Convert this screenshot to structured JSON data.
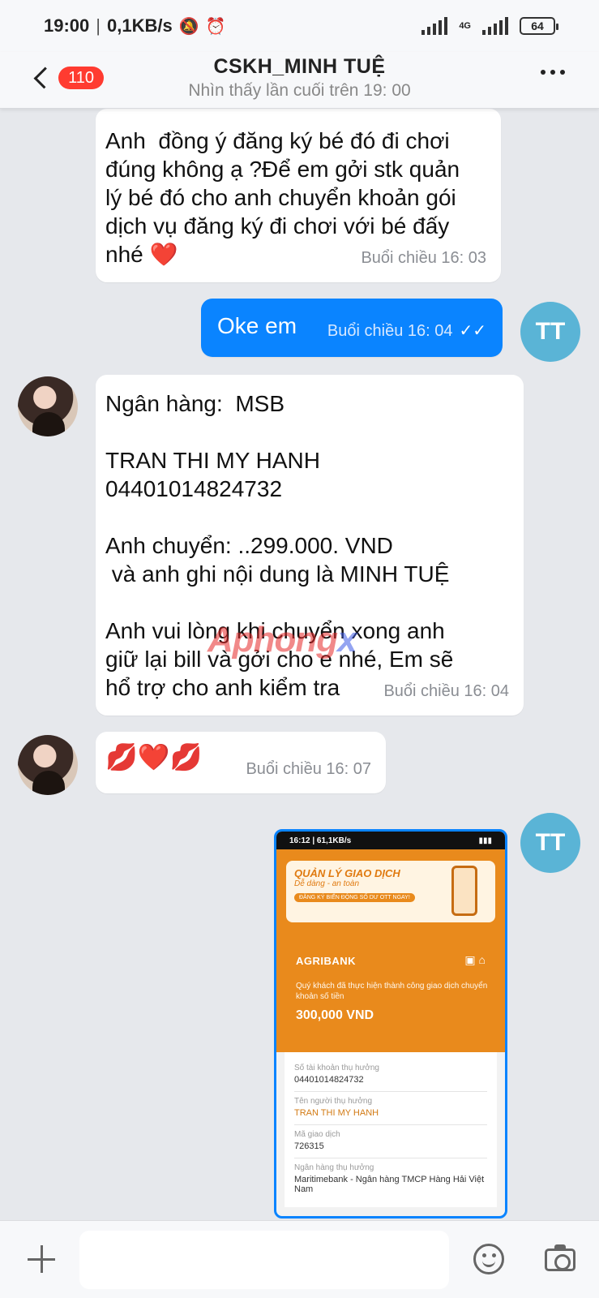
{
  "status_bar": {
    "time": "19:00",
    "speed": "0,1KB/s",
    "network": "4G",
    "battery": "64"
  },
  "header": {
    "unread_count": "110",
    "title": "CSKH_MINH TUỆ",
    "subtitle": "Nhìn thấy lần cuối trên 19: 00"
  },
  "messages": [
    {
      "sender": "other",
      "text": "Anh  đồng ý đăng ký bé đó đi chơi\nđúng không ạ ?Để em gởi stk quản\nlý bé đó cho anh chuyển khoản gói\ndịch vụ đăng ký đi chơi với bé đấy\nnhé ❤️",
      "time": "Buổi chiều  16: 03"
    },
    {
      "sender": "me",
      "text": "Oke em",
      "time": "Buổi chiều  16: 04"
    },
    {
      "sender": "other",
      "text": "Ngân hàng:  MSB\n\nTRAN THI MY HANH\n04401014824732\n\nAnh chuyển: ..299.000. VND\n và anh ghi nội dung là MINH TUỆ\n\nAnh vui lòng khi chuyển xong anh\ngiữ lại bill và gởi cho e nhé, Em sẽ\nhổ trợ cho anh kiểm tra",
      "time": "Buổi chiều  16: 04"
    },
    {
      "sender": "other",
      "text": "💋❤️💋",
      "time": "Buổi chiều  16: 07"
    }
  ],
  "my_avatar_initials": "TT",
  "watermark": {
    "part1": "Aphong",
    "part2": "x"
  },
  "receipt": {
    "status_time": "16:12 | 61,1KB/s",
    "banner_title": "QUẢN LÝ GIAO DỊCH",
    "banner_sub": "Dễ dàng - an toàn",
    "banner_cta": "ĐĂNG KÝ BIẾN ĐỘNG SỐ DƯ OTT NGAY!",
    "brand": "AGRIBANK",
    "message": "Quý khách đã thực hiện thành công giao dịch chuyển khoản số tiền",
    "amount": "300,000 VND",
    "rows": [
      {
        "label": "Số tài khoản thụ hưởng",
        "value": "04401014824732"
      },
      {
        "label": "Tên người thụ hưởng",
        "value": "TRAN THI MY HANH"
      },
      {
        "label": "Mã giao dịch",
        "value": "726315"
      },
      {
        "label": "Ngân hàng thụ hưởng",
        "value": "Maritimebank - Ngân hàng TMCP Hàng Hải Việt Nam"
      }
    ]
  },
  "input": {
    "placeholder": ""
  }
}
